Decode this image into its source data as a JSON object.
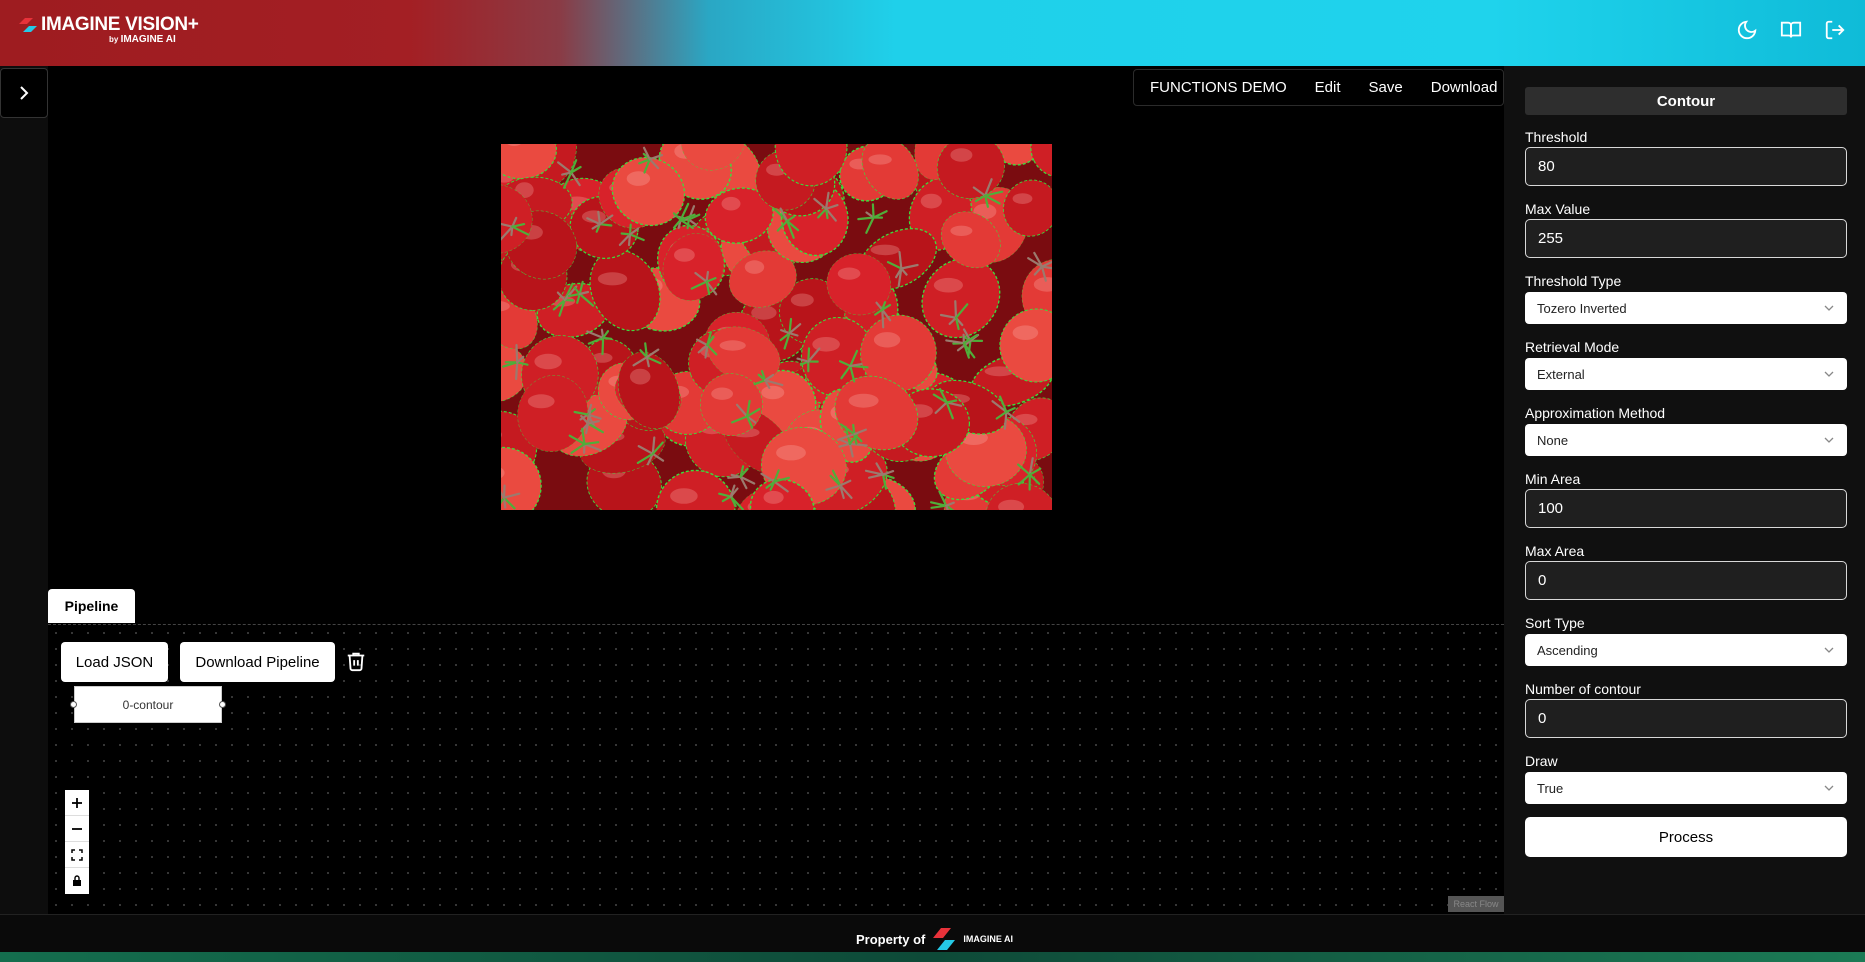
{
  "header": {
    "logo_title": "IMAGINE VISION+",
    "logo_by": "by",
    "logo_company": "IMAGINE AI",
    "icons": [
      "moon-icon",
      "book-icon",
      "logout-icon"
    ]
  },
  "topbar": {
    "items": [
      "FUNCTIONS DEMO",
      "Edit",
      "Save",
      "Download"
    ]
  },
  "pipeline": {
    "tab_label": "Pipeline",
    "load_json": "Load JSON",
    "download_pipeline": "Download Pipeline",
    "node_label": "0-contour",
    "react_flow": "React Flow"
  },
  "panel": {
    "title": "Contour",
    "threshold_label": "Threshold",
    "threshold_value": "80",
    "max_value_label": "Max Value",
    "max_value_value": "255",
    "threshold_type_label": "Threshold Type",
    "threshold_type_value": "Tozero Inverted",
    "retrieval_mode_label": "Retrieval Mode",
    "retrieval_mode_value": "External",
    "approx_label": "Approximation Method",
    "approx_value": "None",
    "min_area_label": "Min Area",
    "min_area_value": "100",
    "max_area_label": "Max Area",
    "max_area_value": "0",
    "sort_type_label": "Sort Type",
    "sort_type_value": "Ascending",
    "num_contour_label": "Number of contour",
    "num_contour_value": "0",
    "draw_label": "Draw",
    "draw_value": "True",
    "process_label": "Process"
  },
  "footer": {
    "property_text": "Property of",
    "logo_text": "IMAGINE AI"
  },
  "colors": {
    "brand_red": "#a31f24",
    "brand_cyan": "#1fd3ec",
    "contour_green": "#3cdc3c"
  }
}
